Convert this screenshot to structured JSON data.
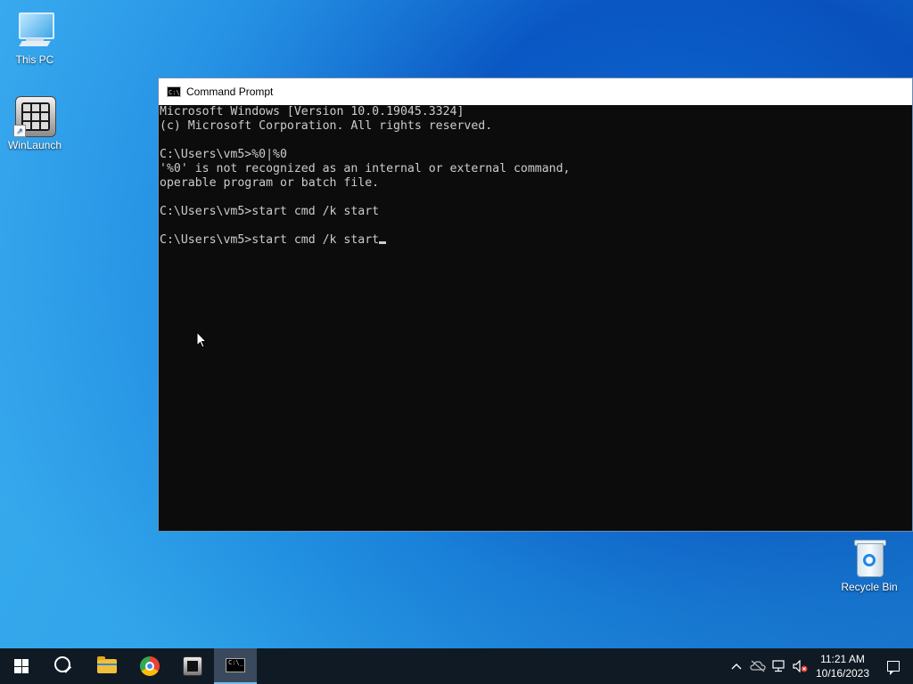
{
  "desktop": {
    "icons": [
      {
        "label": "This PC",
        "icon": "this-pc-icon"
      },
      {
        "label": "WinLaunch",
        "icon": "winlaunch-icon"
      },
      {
        "label": "Recycle Bin",
        "icon": "recycle-bin-icon"
      }
    ]
  },
  "cmd_window": {
    "title": "Command Prompt",
    "lines": [
      "Microsoft Windows [Version 10.0.19045.3324]",
      "(c) Microsoft Corporation. All rights reserved.",
      "",
      "C:\\Users\\vm5>%0|%0",
      "'%0' is not recognized as an internal or external command,",
      "operable program or batch file.",
      "",
      "C:\\Users\\vm5>start cmd /k start",
      ""
    ],
    "current_line": "C:\\Users\\vm5>start cmd /k start"
  },
  "taskbar": {
    "items": [
      {
        "name": "start",
        "icon": "windows-logo-icon"
      },
      {
        "name": "search",
        "icon": "search-icon"
      },
      {
        "name": "file-explorer",
        "icon": "folder-icon"
      },
      {
        "name": "chrome",
        "icon": "chrome-icon"
      },
      {
        "name": "winlaunch",
        "icon": "winlaunch-icon"
      },
      {
        "name": "command-prompt",
        "icon": "cmd-icon",
        "active": true
      }
    ],
    "tray": {
      "chevron": "^",
      "time": "11:21 AM",
      "date": "10/16/2023"
    }
  }
}
